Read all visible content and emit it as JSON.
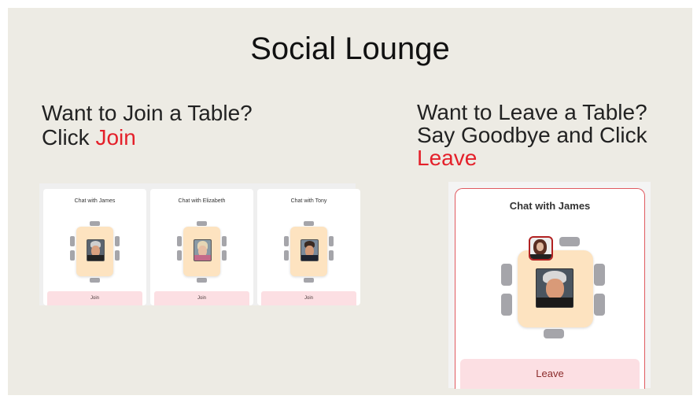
{
  "slide": {
    "title": "Social Lounge",
    "left": {
      "line1": "Want to Join a Table?",
      "line2_prefix": "Click ",
      "line2_action": "Join"
    },
    "right": {
      "line1": "Want to Leave a Table?",
      "line2": "Say Goodbye and Click",
      "line3_action": "Leave"
    }
  },
  "tables": [
    {
      "title": "Chat with James",
      "button": "Join"
    },
    {
      "title": "Chat with Elizabeth",
      "button": "Join"
    },
    {
      "title": "Chat with Tony",
      "button": "Join"
    }
  ],
  "active_table": {
    "title": "Chat with James",
    "button": "Leave"
  },
  "colors": {
    "accent": "#e4202a",
    "table": "#fde3c0",
    "button": "#fcdfe3",
    "seat": "#a5a5aa",
    "background": "#edebe4"
  }
}
